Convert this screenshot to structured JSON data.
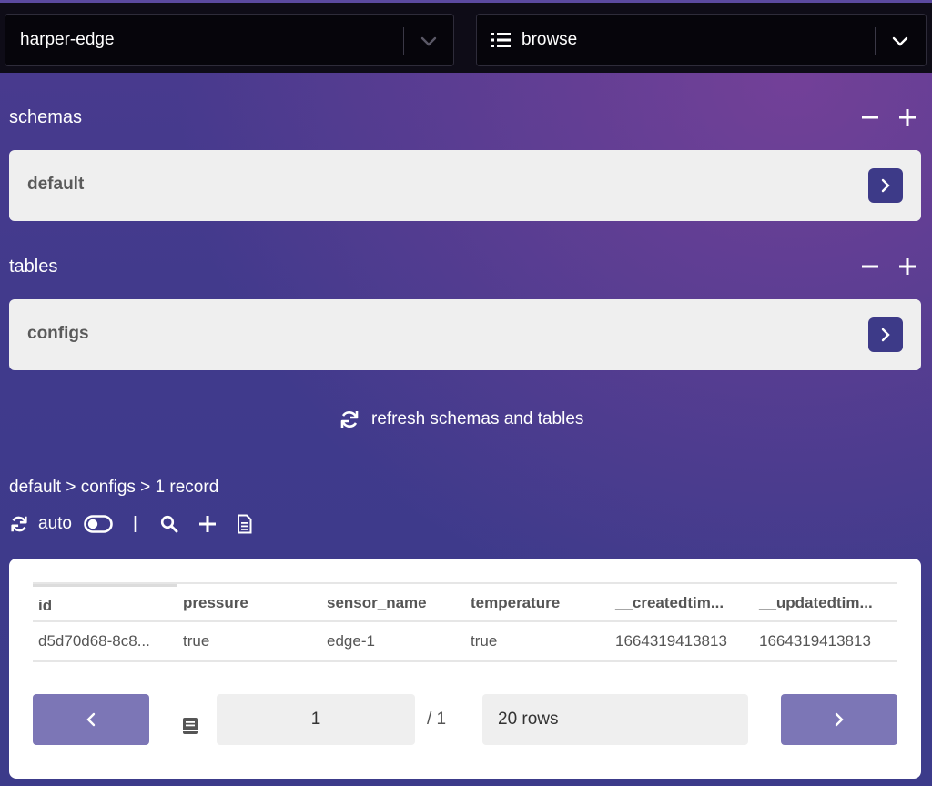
{
  "header": {
    "instance_select": {
      "value": "harper-edge",
      "icon": "chevron-down-icon"
    },
    "section_select": {
      "value": "browse",
      "icon": "list-icon"
    }
  },
  "schemas": {
    "label": "schemas",
    "items": [
      {
        "name": "default"
      }
    ]
  },
  "tables": {
    "label": "tables",
    "items": [
      {
        "name": "configs"
      }
    ]
  },
  "refresh_label": "refresh schemas and tables",
  "breadcrumb": "default > configs > 1 record",
  "toolbar": {
    "auto_label": "auto",
    "separator": "|"
  },
  "table": {
    "columns": [
      "id",
      "pressure",
      "sensor_name",
      "temperature",
      "__createdtim...",
      "__updatedtim..."
    ],
    "rows": [
      [
        "d5d70d68-8c8...",
        "true",
        "edge-1",
        "true",
        "1664319413813",
        "1664319413813"
      ]
    ]
  },
  "pagination": {
    "page": "1",
    "total": "/ 1",
    "rows_label": "20 rows"
  },
  "colors": {
    "accent": "#3d3a88",
    "pager_button": "#7c76b6",
    "card": "#efefef",
    "topbar": "#0e0c17"
  }
}
